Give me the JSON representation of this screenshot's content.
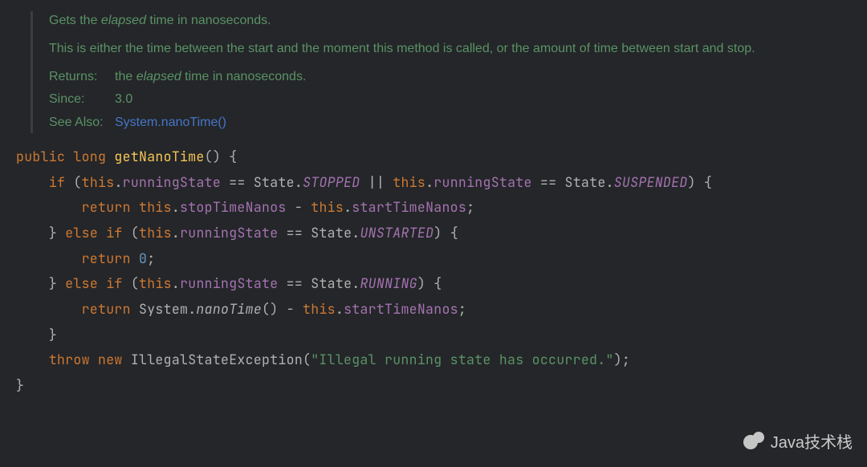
{
  "doc": {
    "summary_pre": "Gets the ",
    "summary_em": "elapsed",
    "summary_post": " time in nanoseconds.",
    "desc": "This is either the time between the start and the moment this method is called, or the amount of time between start and stop.",
    "returns_label": "Returns:",
    "returns_pre": "the ",
    "returns_em": "elapsed",
    "returns_post": " time in nanoseconds.",
    "since_label": "Since:",
    "since_value": "3.0",
    "seealso_label": "See Also:",
    "seealso_link": "System.nanoTime()"
  },
  "code": {
    "kw_public": "public",
    "kw_long": "long",
    "fn_name": "getNanoTime",
    "kw_if": "if",
    "kw_else": "else",
    "kw_return": "return",
    "kw_throw": "throw",
    "kw_new": "new",
    "kw_this": "this",
    "mem_runningState": "runningState",
    "mem_stopTimeNanos": "stopTimeNanos",
    "mem_startTimeNanos": "startTimeNanos",
    "cls_State": "State",
    "cls_System": "System",
    "cls_Exception": "IllegalStateException",
    "enu_STOPPED": "STOPPED",
    "enu_SUSPENDED": "SUSPENDED",
    "enu_UNSTARTED": "UNSTARTED",
    "enu_RUNNING": "RUNNING",
    "stat_nanoTime": "nanoTime",
    "num_zero": "0",
    "str_msg": "\"Illegal running state has occurred.\""
  },
  "watermark": {
    "text": "Java技术栈"
  }
}
